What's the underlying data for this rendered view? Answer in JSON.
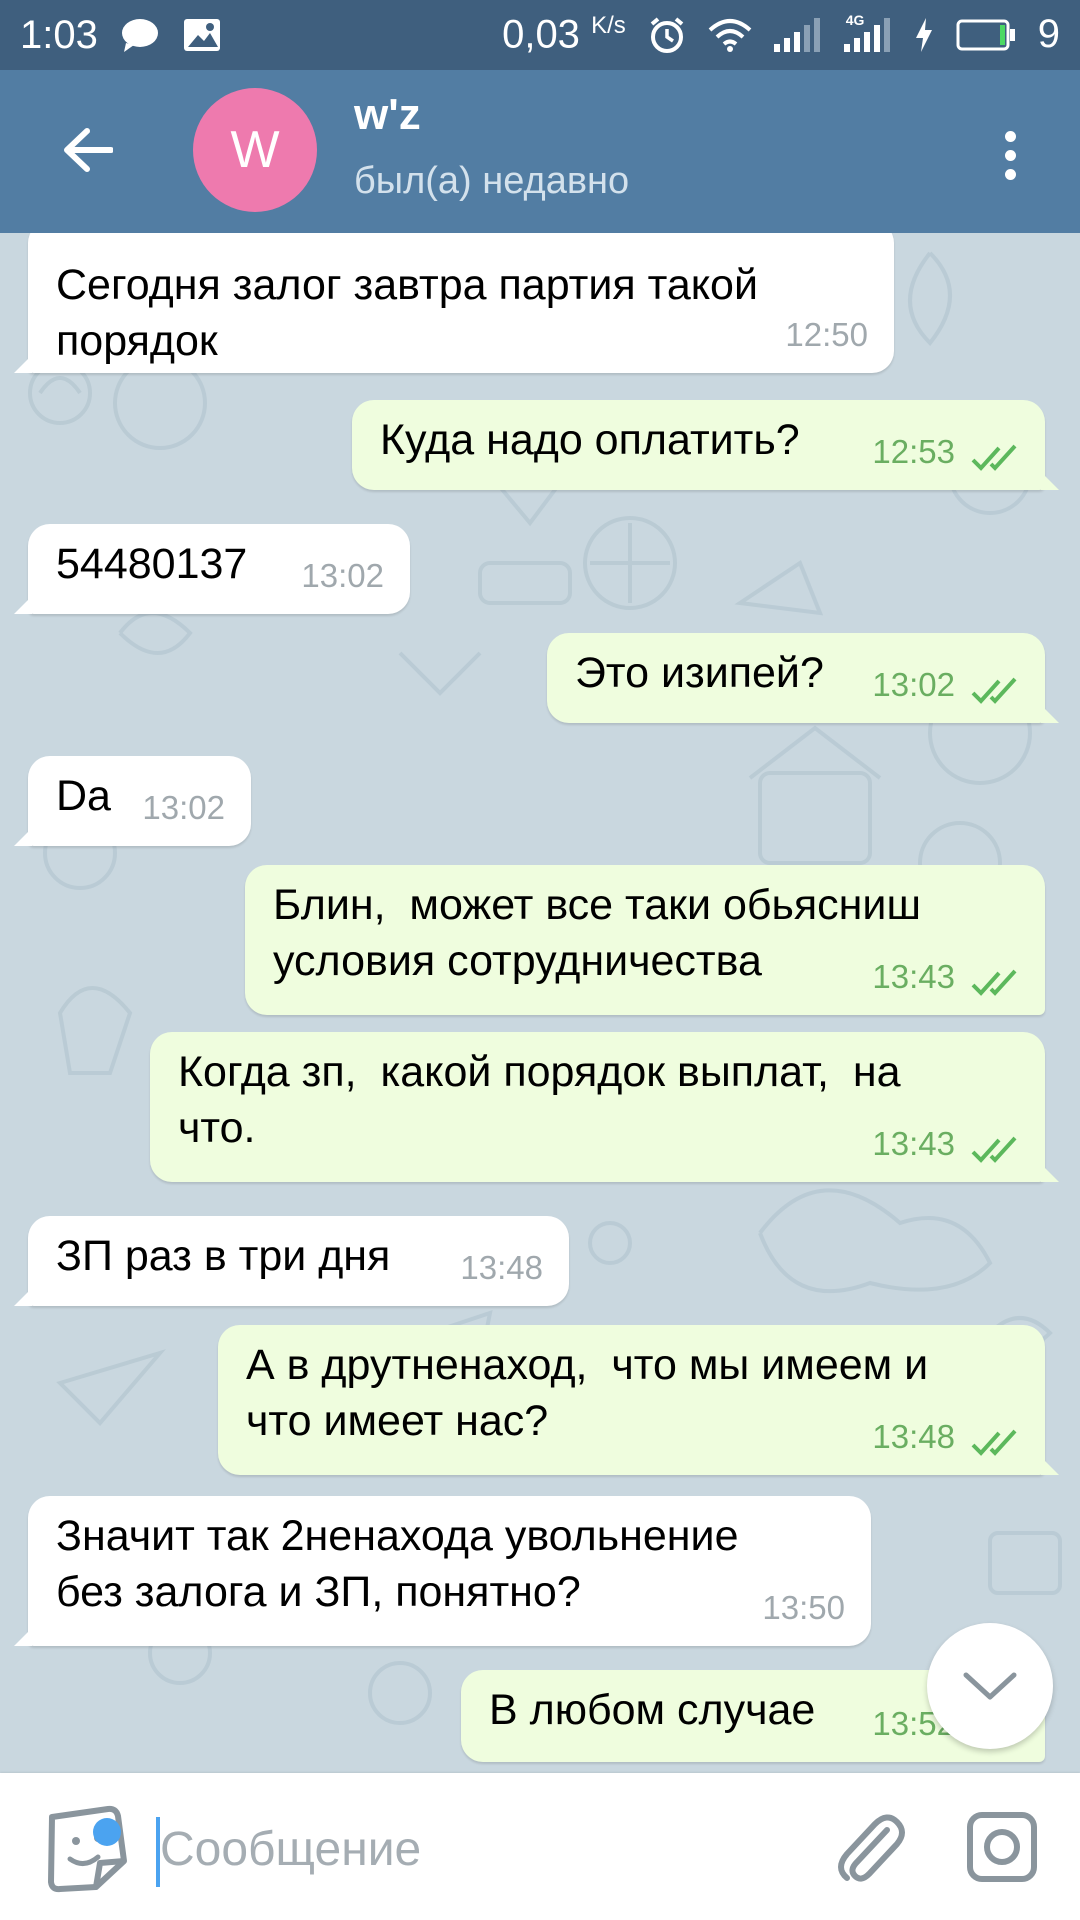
{
  "status_bar": {
    "time": "1:03",
    "speed": "0,03",
    "speed_unit": "K/s",
    "network_label": "4G",
    "battery": "9"
  },
  "header": {
    "avatar_letter": "W",
    "name": "w'z",
    "status": "был(а) недавно"
  },
  "messages": [
    {
      "dir": "in",
      "text": "Сегодня залог завтра партия такой\nпорядок",
      "time": "12:50"
    },
    {
      "dir": "out",
      "text": "Куда надо оплатить?",
      "time": "12:53",
      "read": true
    },
    {
      "dir": "in",
      "text": "54480137",
      "time": "13:02"
    },
    {
      "dir": "out",
      "text": "Это изипей?",
      "time": "13:02",
      "read": true
    },
    {
      "dir": "in",
      "text": "Da",
      "time": "13:02"
    },
    {
      "dir": "out",
      "text": "Блин,  может все таки обьясниш\nусловия сотрудничества",
      "time": "13:43",
      "read": true
    },
    {
      "dir": "out",
      "text": "Когда зп,  какой порядок выплат,  на\nчто.",
      "time": "13:43",
      "read": true
    },
    {
      "dir": "in",
      "text": "ЗП раз в три дня",
      "time": "13:48"
    },
    {
      "dir": "out",
      "text": "А в друтненаход,  что мы имеем и\nчто имеет нас?",
      "time": "13:48",
      "read": true
    },
    {
      "dir": "in",
      "text": "Значит так 2ненахода увольнение\nбез залога и ЗП, понятно?",
      "time": "13:50"
    },
    {
      "dir": "out",
      "text": "В любом случае",
      "time": "13:52",
      "read": true
    }
  ],
  "input": {
    "placeholder": "Сообщение",
    "value": ""
  },
  "colors": {
    "status_bar": "#3f5f7e",
    "header": "#527da3",
    "avatar": "#ee7aae",
    "incoming_bubble": "#ffffff",
    "outgoing_bubble": "#effdde",
    "outgoing_time": "#6aae61",
    "accent": "#4ba3f0"
  },
  "icons": [
    "chat-bubble-icon",
    "image-icon",
    "alarm-icon",
    "wifi-icon",
    "signal-icon",
    "charging-icon",
    "battery-icon",
    "back-arrow-icon",
    "more-vert-icon",
    "double-check-icon",
    "chevron-down-icon",
    "sticker-icon",
    "paperclip-icon",
    "camera-icon"
  ]
}
